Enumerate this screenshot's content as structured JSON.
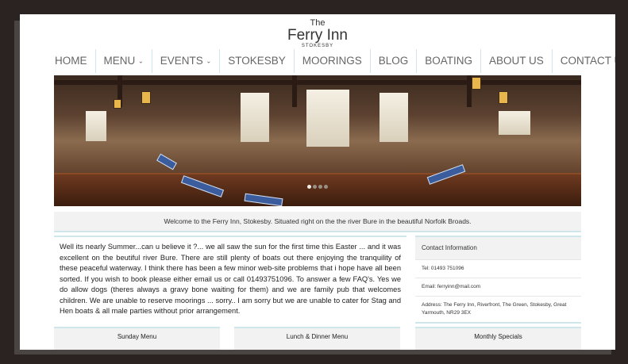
{
  "logo": {
    "the": "The",
    "name": "Ferry Inn",
    "place": "STOKESBY"
  },
  "nav": {
    "items": [
      {
        "label": "HOME"
      },
      {
        "label": "MENU",
        "caret": "⌄"
      },
      {
        "label": "EVENTS",
        "caret": "⌄"
      },
      {
        "label": "STOKESBY"
      },
      {
        "label": "MOORINGS"
      },
      {
        "label": "BLOG"
      },
      {
        "label": "BOATING"
      },
      {
        "label": "ABOUT US"
      },
      {
        "label": "CONTACT US"
      }
    ]
  },
  "banner": {
    "slides": 4,
    "active_slide": 1
  },
  "welcome": "Welcome to the Ferry Inn, Stokesby. Situated right on the the river Bure in the beautiful Norfolk Broads.",
  "intro": "Well its nearly Summer...can u believe it ?... we all saw the sun for the first time this Easter ... and it was excellent on the beutiful river Bure. There are still plenty of boats out there enjoying the tranquility of these peaceful waterway. I think there has been a few minor web-site problems that i hope have all been sorted. If you wish to book please either email us or call 01493751096. To answer a few FAQ's. Yes we do allow dogs (theres always a gravy bone waiting for them) and we are family pub that welcomes children. We are unable to reserve moorings ... sorry.. I am sorry but we are unable to cater for Stag and Hen boats & all male parties without prior arrangement.",
  "contact": {
    "heading": "Contact Information",
    "tel": "Tel: 01493 751096",
    "email": "Email: ferryinn@mail.com",
    "address": "Address: The Ferry Inn, Riverfront, The Green, Stokesby, Great Yarmouth, NR29 3EX"
  },
  "menus": {
    "sunday": "Sunday Menu",
    "lunch_dinner": "Lunch & Dinner Menu",
    "specials": "Monthly Specials"
  }
}
